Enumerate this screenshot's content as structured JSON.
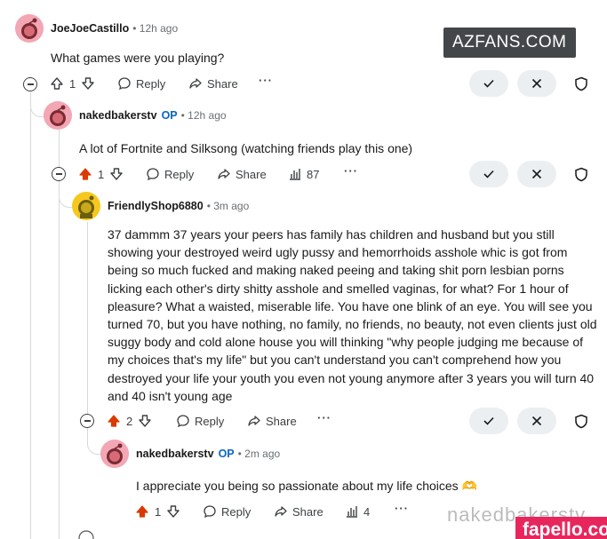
{
  "watermarks": {
    "top_right": "AZFANS.COM",
    "bottom_right_faded": "nakedbakerstv",
    "bottom_right_badge": "fapello.com"
  },
  "actions": {
    "reply": "Reply",
    "share": "Share"
  },
  "comments": [
    {
      "author": "JoeJoeCastillo",
      "op": "",
      "time": "12h ago",
      "body": "What games were you playing?",
      "votes": "1",
      "views": "",
      "upvoted": false
    },
    {
      "author": "nakedbakerstv",
      "op": "OP",
      "time": "12h ago",
      "body": "A lot of Fortnite and Silksong (watching friends play this one)",
      "votes": "1",
      "views": "87",
      "upvoted": true
    },
    {
      "author": "FriendlyShop6880",
      "op": "",
      "time": "3m ago",
      "body": "37 dammm 37 years your peers has family has children and husband but you still showing your destroyed weird ugly pussy and hemorrhoids asshole whic is got from being so much fucked and making naked peeing and taking shit porn lesbian porns licking each other's dirty shitty asshole and smelled vaginas, for what? For 1 hour of pleasure? What a waisted, miserable life. You have one blink of an eye. You will see you turned 70, but you have nothing, no family, no friends, no beauty, not even clients just old suggy body and cold alone house you will thinking \"why people judging me because of my choices that's my life\" but you can't understand you can't comprehend how you destroyed your life your youth you even not young anymore after 3 years you will turn 40 and 40 isn't young age",
      "votes": "2",
      "views": "",
      "upvoted": true
    },
    {
      "author": "nakedbakerstv",
      "op": "OP",
      "time": "2m ago",
      "body": "I appreciate you being so passionate about my life choices 🫶",
      "votes": "1",
      "views": "4",
      "upvoted": true
    }
  ],
  "colors": {
    "upvote_active": "#d93a00",
    "op_blue": "#0a66c2",
    "muted": "#6a6f73"
  }
}
